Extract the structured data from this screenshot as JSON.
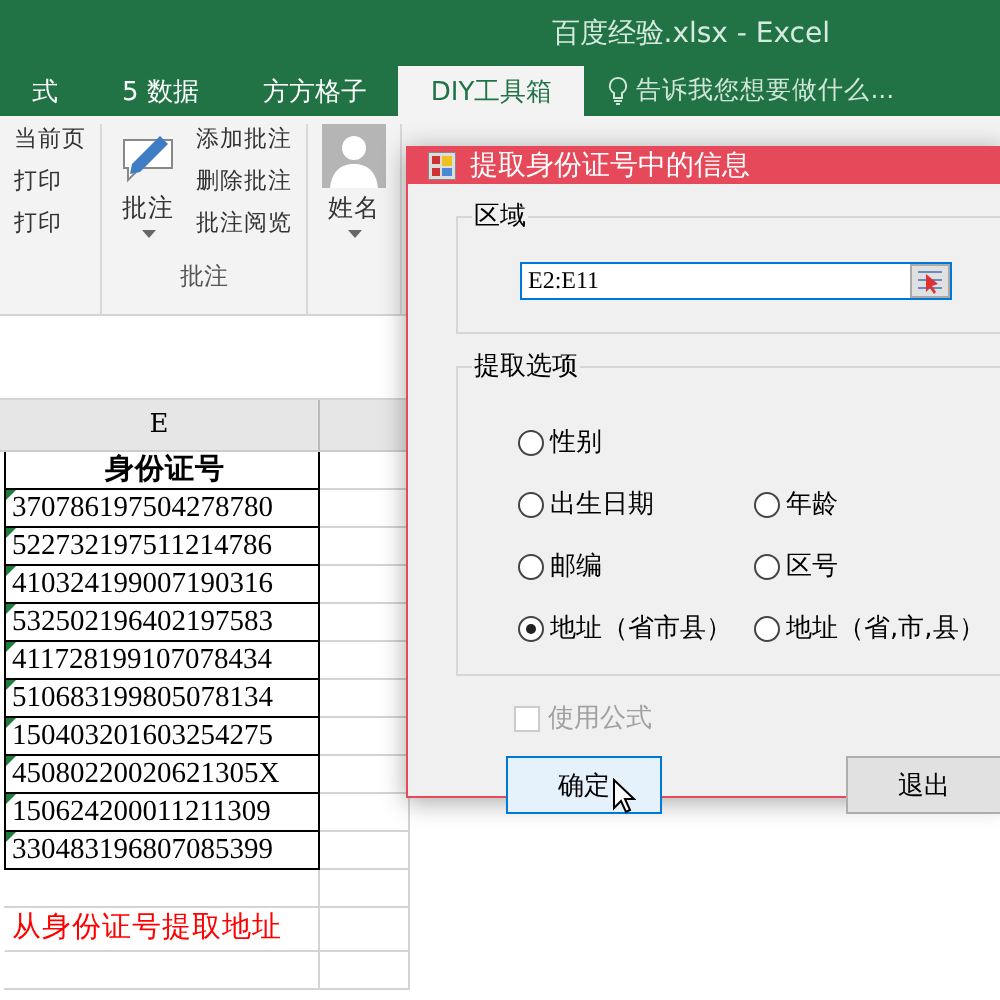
{
  "window": {
    "title": "百度经验.xlsx - Excel"
  },
  "tabs": [
    {
      "label": "式",
      "selected": false
    },
    {
      "label": "5 数据",
      "selected": false
    },
    {
      "label": "方方格子",
      "selected": false
    },
    {
      "label": "DIY工具箱",
      "selected": true
    }
  ],
  "tell_me": {
    "placeholder": "告诉我您想要做什么..."
  },
  "ribbon": {
    "print_items": [
      "当前页",
      "打印",
      "打印"
    ],
    "comment_button": "批注",
    "comment_items": [
      "添加批注",
      "删除批注",
      "批注阅览"
    ],
    "comment_group": "批注",
    "name_button": "姓名"
  },
  "sheet": {
    "column": "E",
    "header": "身份证号",
    "rows": [
      "370786197504278780",
      "522732197511214786",
      "410324199007190316",
      "532502196402197583",
      "411728199107078434",
      "510683199805078134",
      "150403201603254275",
      "45080220020621305X",
      "150624200011211309",
      "330483196807085399"
    ],
    "note": "从身份证号提取地址"
  },
  "dialog": {
    "title": "提取身份证号中的信息",
    "range_group": "区域",
    "range_value": "E2:E11",
    "options_group": "提取选项",
    "options": [
      {
        "label": "性别",
        "selected": false
      },
      {
        "label": "出生日期",
        "selected": false
      },
      {
        "label": "年龄",
        "selected": false
      },
      {
        "label": "邮编",
        "selected": false
      },
      {
        "label": "区号",
        "selected": false
      },
      {
        "label": "地址（省市县）",
        "selected": true
      },
      {
        "label": "地址（省,市,县）",
        "selected": false
      }
    ],
    "use_formula": {
      "label": "使用公式",
      "checked": false,
      "disabled": true
    },
    "buttons": [
      {
        "label": "确定",
        "focused": true
      },
      {
        "label": "退出",
        "focused": false
      }
    ]
  }
}
